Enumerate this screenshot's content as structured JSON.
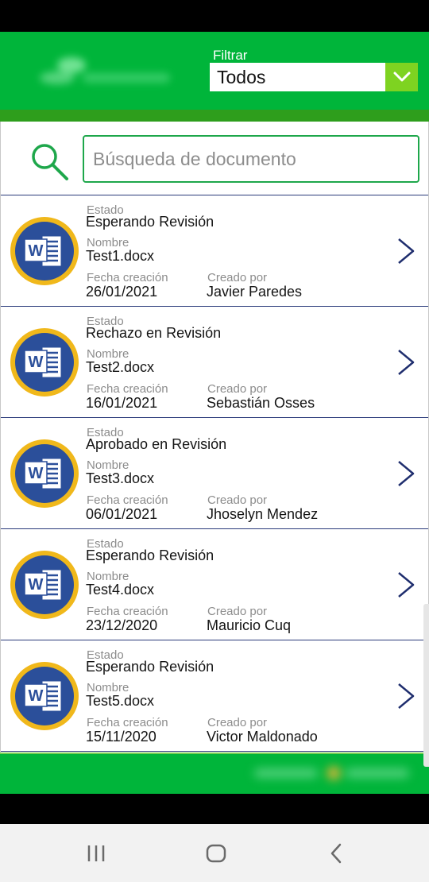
{
  "header": {
    "filter_label": "Filtrar",
    "filter_value": "Todos",
    "colors": {
      "header": "#00b53a",
      "stripe": "#2e9e1c",
      "dropdown_button": "#7ed321"
    }
  },
  "search": {
    "placeholder": "Búsqueda de documento",
    "icon": "search-icon"
  },
  "labels": {
    "estado": "Estado",
    "nombre": "Nombre",
    "fecha": "Fecha creación",
    "creado": "Creado por"
  },
  "documents": [
    {
      "estado": "Esperando Revisión",
      "nombre": "Test1.docx",
      "fecha": "26/01/2021",
      "creado": "Javier Paredes",
      "icon": "word-document-icon"
    },
    {
      "estado": "Rechazo en Revisión",
      "nombre": "Test2.docx",
      "fecha": "16/01/2021",
      "creado": "Sebastián Osses",
      "icon": "word-document-icon"
    },
    {
      "estado": "Aprobado en Revisión",
      "nombre": "Test3.docx",
      "fecha": "06/01/2021",
      "creado": "Jhoselyn Mendez",
      "icon": "word-document-icon"
    },
    {
      "estado": "Esperando Revisión",
      "nombre": "Test4.docx",
      "fecha": "23/12/2020",
      "creado": "Mauricio Cuq",
      "icon": "word-document-icon"
    },
    {
      "estado": "Esperando Revisión",
      "nombre": "Test5.docx",
      "fecha": "15/11/2020",
      "creado": "Victor Maldonado",
      "icon": "word-document-icon"
    }
  ],
  "nav": [
    "recent-apps-icon",
    "home-icon",
    "back-icon"
  ]
}
